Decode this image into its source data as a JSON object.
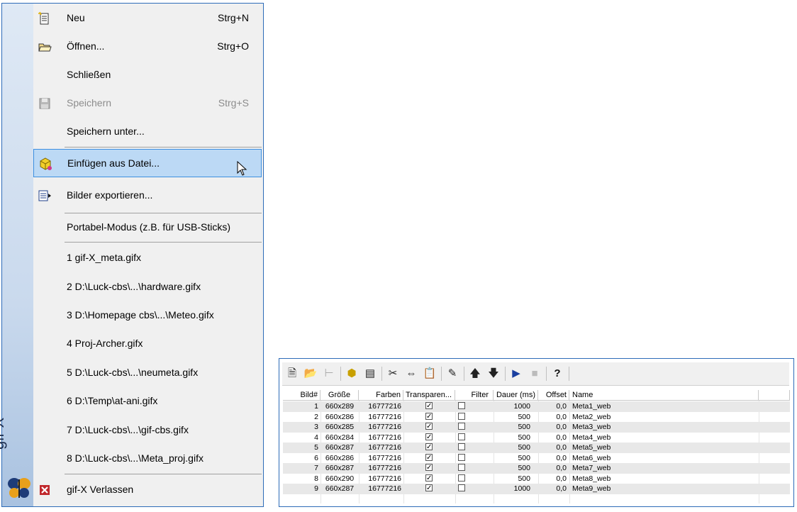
{
  "menu": {
    "side_label": "gif-X",
    "items": [
      {
        "label": "Neu",
        "shortcut": "Strg+N",
        "icon": "new-document-icon"
      },
      {
        "label": "Öffnen...",
        "shortcut": "Strg+O",
        "icon": "open-folder-icon"
      },
      {
        "label": "Schließen",
        "shortcut": "",
        "icon": ""
      },
      {
        "label": "Speichern",
        "shortcut": "Strg+S",
        "icon": "save-disk-icon"
      },
      {
        "label": "Speichern unter...",
        "shortcut": "",
        "icon": ""
      },
      {
        "label": "Einfügen aus Datei...",
        "shortcut": "",
        "icon": "insert-from-file-icon"
      },
      {
        "label": "Bilder exportieren...",
        "shortcut": "",
        "icon": "export-images-icon"
      },
      {
        "label": "Portabel-Modus (z.B. für USB-Sticks)",
        "shortcut": "",
        "icon": ""
      },
      {
        "label": "1 gif-X_meta.gifx",
        "shortcut": "",
        "icon": ""
      },
      {
        "label": "2 D:\\Luck-cbs\\...\\hardware.gifx",
        "shortcut": "",
        "icon": ""
      },
      {
        "label": "3 D:\\Homepage cbs\\...\\Meteo.gifx",
        "shortcut": "",
        "icon": ""
      },
      {
        "label": "4 Proj-Archer.gifx",
        "shortcut": "",
        "icon": ""
      },
      {
        "label": "5 D:\\Luck-cbs\\...\\neumeta.gifx",
        "shortcut": "",
        "icon": ""
      },
      {
        "label": "6 D:\\Temp\\at-ani.gifx",
        "shortcut": "",
        "icon": ""
      },
      {
        "label": "7 D:\\Luck-cbs\\...\\gif-cbs.gifx",
        "shortcut": "",
        "icon": ""
      },
      {
        "label": "8 D:\\Luck-cbs\\...\\Meta_proj.gifx",
        "shortcut": "",
        "icon": ""
      },
      {
        "label": "gif-X Verlassen",
        "shortcut": "",
        "icon": "exit-x-icon"
      }
    ]
  },
  "grid": {
    "toolbar_icons": [
      "new-icon",
      "open-icon",
      "frame-size-icon",
      "insert-icon",
      "export-icon",
      "cut-icon",
      "copy-frame-icon",
      "paste-icon",
      "properties-icon",
      "move-up-icon",
      "move-down-icon",
      "play-icon",
      "stop-icon",
      "help-icon"
    ],
    "columns": [
      "Bild#",
      "Größe",
      "Farben",
      "Transparen...",
      "Filter",
      "Dauer (ms)",
      "Offset",
      "Name"
    ],
    "rows": [
      {
        "num": "1",
        "size": "660x289",
        "colors": "16777216",
        "transparent": true,
        "filter": false,
        "duration": "1000",
        "offset": "0,0",
        "name": "Meta1_web"
      },
      {
        "num": "2",
        "size": "660x286",
        "colors": "16777216",
        "transparent": true,
        "filter": false,
        "duration": "500",
        "offset": "0,0",
        "name": "Meta2_web"
      },
      {
        "num": "3",
        "size": "660x285",
        "colors": "16777216",
        "transparent": true,
        "filter": false,
        "duration": "500",
        "offset": "0,0",
        "name": "Meta3_web"
      },
      {
        "num": "4",
        "size": "660x284",
        "colors": "16777216",
        "transparent": true,
        "filter": false,
        "duration": "500",
        "offset": "0,0",
        "name": "Meta4_web"
      },
      {
        "num": "5",
        "size": "660x287",
        "colors": "16777216",
        "transparent": true,
        "filter": false,
        "duration": "500",
        "offset": "0,0",
        "name": "Meta5_web"
      },
      {
        "num": "6",
        "size": "660x286",
        "colors": "16777216",
        "transparent": true,
        "filter": false,
        "duration": "500",
        "offset": "0,0",
        "name": "Meta6_web"
      },
      {
        "num": "7",
        "size": "660x287",
        "colors": "16777216",
        "transparent": true,
        "filter": false,
        "duration": "500",
        "offset": "0,0",
        "name": "Meta7_web"
      },
      {
        "num": "8",
        "size": "660x290",
        "colors": "16777216",
        "transparent": true,
        "filter": false,
        "duration": "500",
        "offset": "0,0",
        "name": "Meta8_web"
      },
      {
        "num": "9",
        "size": "660x287",
        "colors": "16777216",
        "transparent": true,
        "filter": false,
        "duration": "1000",
        "offset": "0,0",
        "name": "Meta9_web"
      }
    ]
  }
}
